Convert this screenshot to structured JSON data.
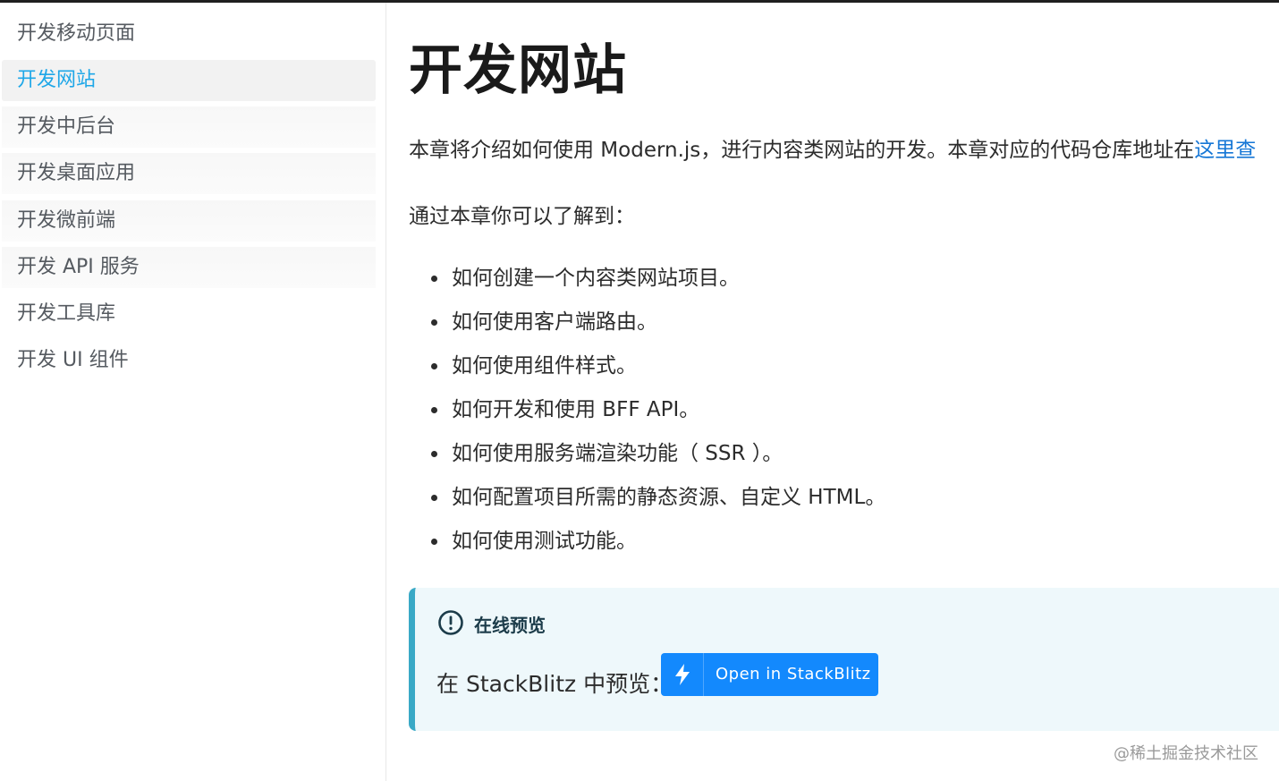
{
  "sidebar": {
    "items": [
      {
        "label": "开发移动页面"
      },
      {
        "label": "开发网站"
      },
      {
        "label": "开发中后台"
      },
      {
        "label": "开发桌面应用"
      },
      {
        "label": "开发微前端"
      },
      {
        "label": "开发 API 服务"
      },
      {
        "label": "开发工具库"
      },
      {
        "label": "开发 UI 组件"
      }
    ],
    "active_index": 1
  },
  "main": {
    "title": "开发网站",
    "intro": {
      "text": "本章将介绍如何使用 Modern.js，进行内容类网站的开发。本章对应的代码仓库地址在",
      "link_text": "这里查"
    },
    "subtitle": "通过本章你可以了解到：",
    "bullets": [
      "如何创建一个内容类网站项目。",
      "如何使用客户端路由。",
      "如何使用组件样式。",
      "如何开发和使用 BFF API。",
      "如何使用服务端渲染功能（ SSR ）。",
      "如何配置项目所需的静态资源、自定义 HTML。",
      "如何使用测试功能。"
    ],
    "callout": {
      "icon": "exclamation-circle-icon",
      "title": "在线预览",
      "text": "在 StackBlitz 中预览：",
      "button_label": "Open in StackBlitz",
      "button_icon": "lightning-bolt-icon"
    }
  },
  "watermark": "@稀土掘金技术社区",
  "colors": {
    "active_nav": "#1ea7e8",
    "link": "#1677d6",
    "callout_bg": "#eef8fb",
    "callout_border": "#39a9c6",
    "stackblitz_button": "#1389fd"
  }
}
